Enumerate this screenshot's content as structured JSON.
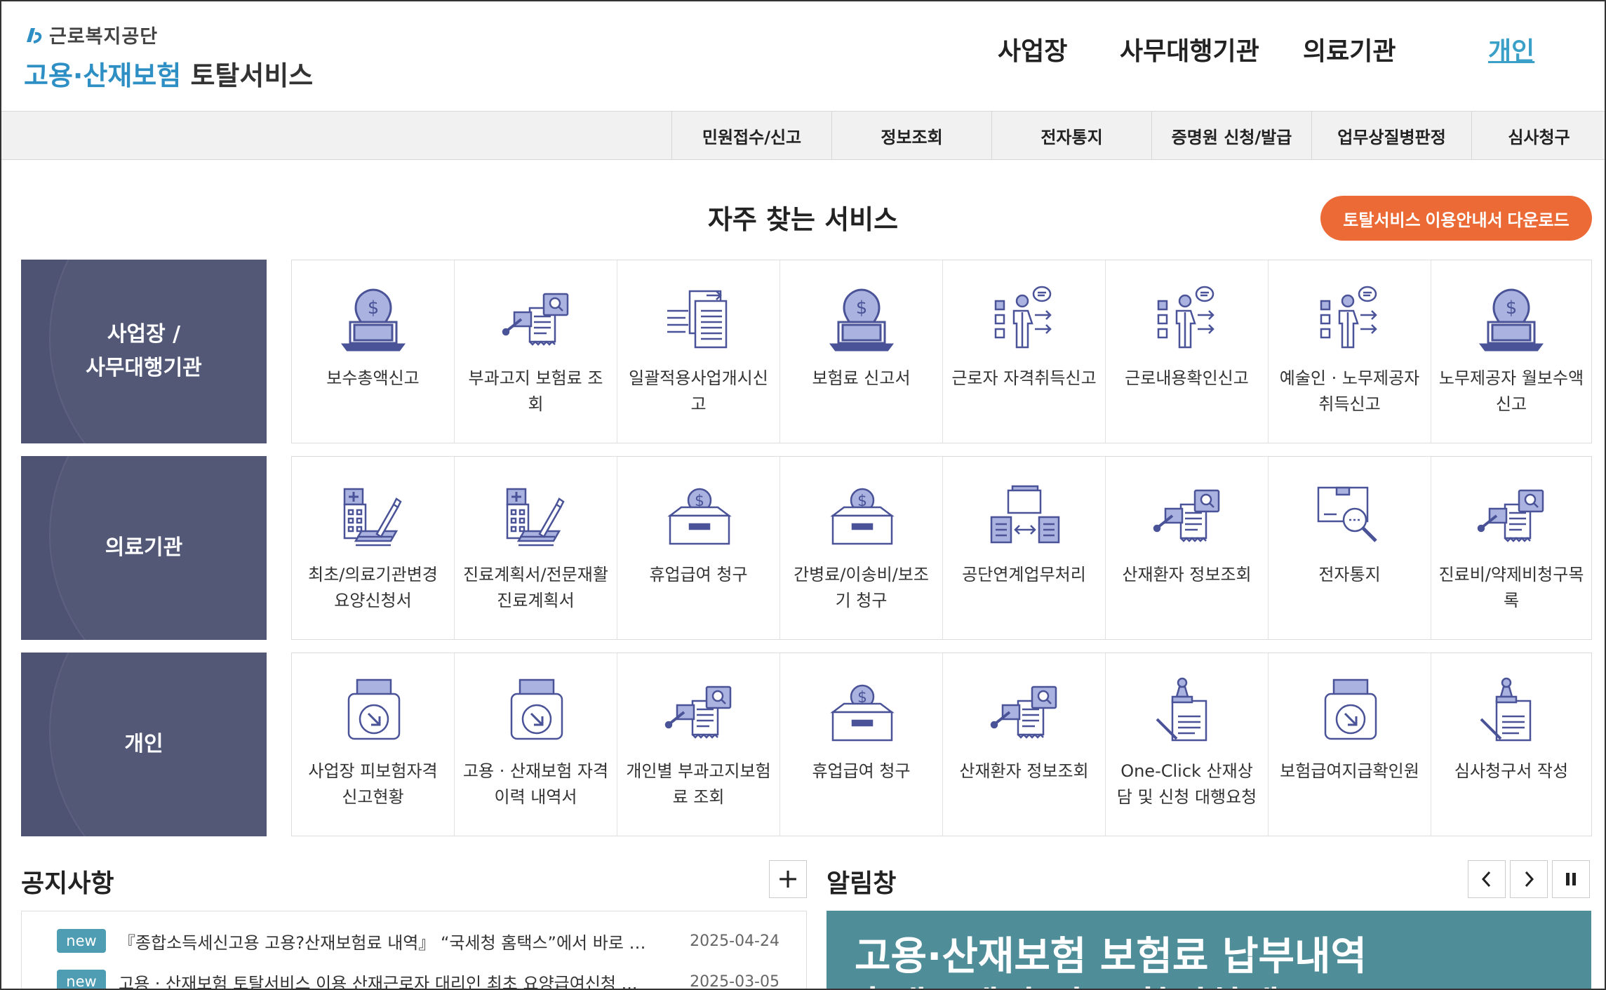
{
  "logo": {
    "org": "근로복지공단",
    "service_blue": "고용·산재보험",
    "service_dark": "토탈서비스"
  },
  "top_nav": [
    {
      "label": "사업장",
      "active": false
    },
    {
      "label": "사무대행기관",
      "active": false
    },
    {
      "label": "의료기관",
      "active": false
    },
    {
      "label": "개인",
      "active": true
    }
  ],
  "gnb": [
    "민원접수/신고",
    "정보조회",
    "전자통지",
    "증명원 신청/발급",
    "업무상질병판정",
    "심사청구"
  ],
  "frequent": {
    "title": "자주 찾는 서비스",
    "download_label": "토탈서비스 이용안내서 다운로드"
  },
  "rows": [
    {
      "category": "사업장 /\n사무대행기관",
      "services": [
        {
          "label": "보수총액신고",
          "icon": "money-laptop-icon"
        },
        {
          "label": "부과고지 보험료 조회",
          "icon": "document-search-icon"
        },
        {
          "label": "일괄적용사업개시신고",
          "icon": "document-list-icon"
        },
        {
          "label": "보험료 신고서",
          "icon": "money-laptop-icon"
        },
        {
          "label": "근로자 자격취득신고",
          "icon": "presenter-icon"
        },
        {
          "label": "근로내용확인신고",
          "icon": "presenter-icon"
        },
        {
          "label": "예술인 · 노무제공자 취득신고",
          "icon": "presenter-icon"
        },
        {
          "label": "노무제공자 월보수액 신고",
          "icon": "money-laptop-icon"
        }
      ]
    },
    {
      "category": "의료기관",
      "services": [
        {
          "label": "최초/의료기관변경 요양신청서",
          "icon": "hospital-pen-icon"
        },
        {
          "label": "진료계획서/전문재활진료계획서",
          "icon": "hospital-pen-icon"
        },
        {
          "label": "휴업급여 청구",
          "icon": "coin-box-icon"
        },
        {
          "label": "간병료/이송비/보조기 청구",
          "icon": "coin-box-icon"
        },
        {
          "label": "공단연계업무처리",
          "icon": "exchange-icon"
        },
        {
          "label": "산재환자 정보조회",
          "icon": "document-search-icon"
        },
        {
          "label": "전자통지",
          "icon": "box-search-icon"
        },
        {
          "label": "진료비/약제비청구목록",
          "icon": "document-search-icon"
        }
      ]
    },
    {
      "category": "개인",
      "services": [
        {
          "label": "사업장 피보험자격 신고현황",
          "icon": "download-printer-icon"
        },
        {
          "label": "고용 · 산재보험 자격 이력 내역서",
          "icon": "download-printer-icon"
        },
        {
          "label": "개인별 부과고지보험료 조회",
          "icon": "document-search-icon"
        },
        {
          "label": "휴업급여 청구",
          "icon": "coin-box-icon"
        },
        {
          "label": "산재환자 정보조회",
          "icon": "document-search-icon"
        },
        {
          "label": "One-Click 산재상담 및 신청 대행요청",
          "icon": "stamp-document-icon"
        },
        {
          "label": "보험급여지급확인원",
          "icon": "download-printer-icon"
        },
        {
          "label": "심사청구서 작성",
          "icon": "stamp-document-icon"
        }
      ]
    }
  ],
  "notice": {
    "title": "공지사항",
    "items": [
      {
        "badge": "new",
        "text": "『종합소득세신고용 고용?산재보험료 내역』 “국세청 홈택스”에서 바로 확...",
        "date": "2025-04-24"
      },
      {
        "badge": "new",
        "text": "고용 · 산재보험 토탈서비스 이용 산재근로자 대리인 최초 요양급여신청 ...",
        "date": "2025-03-05"
      }
    ]
  },
  "alert": {
    "title": "알림창",
    "banner_line1": "고용·산재보험 보험료 납부내역",
    "banner_line2": "홈택스에서 바로 확인하세요!"
  },
  "colors": {
    "category_bg": "#4e5373",
    "icon_blue": "#5c6bb0",
    "accent_orange": "#ec6a35",
    "link_active": "#3aa0c8",
    "badge": "#4f9db3"
  }
}
